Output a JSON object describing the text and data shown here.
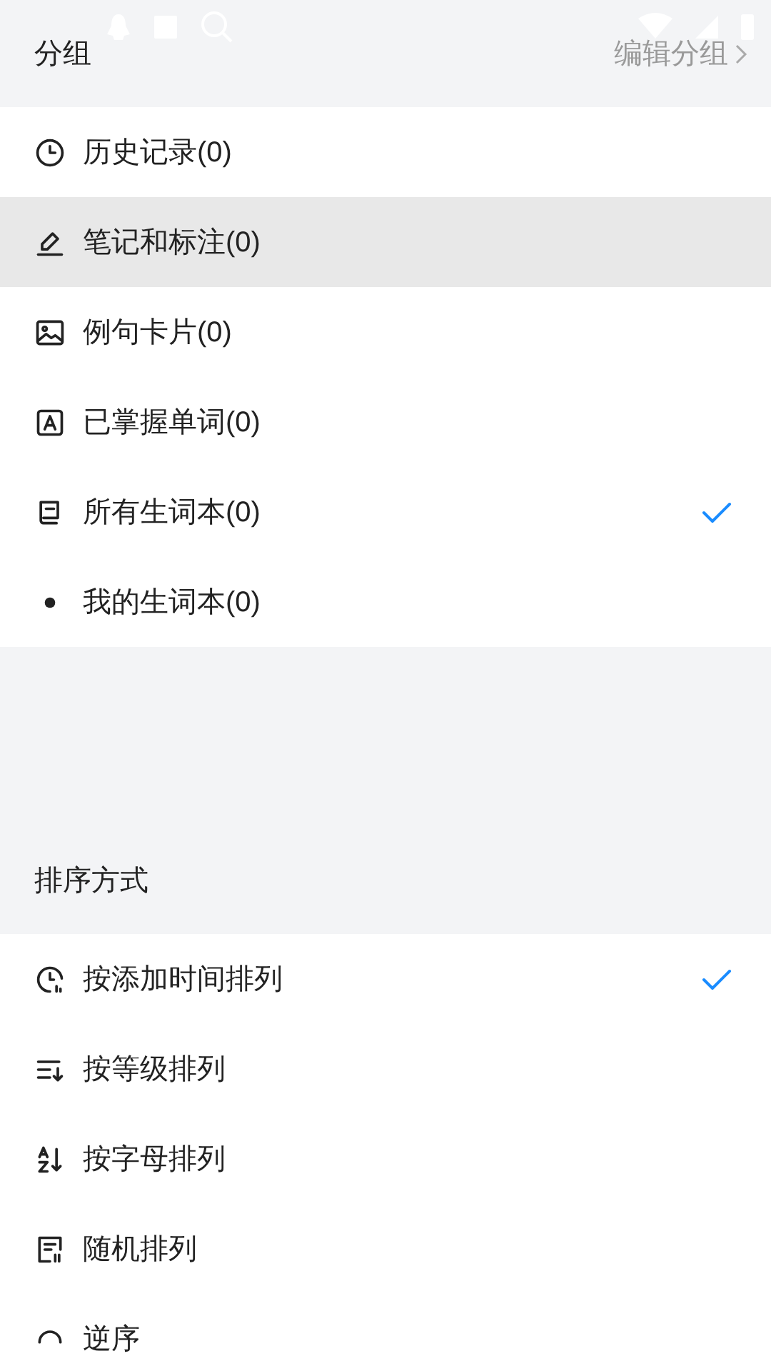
{
  "groups": {
    "title": "分组",
    "edit_link": "编辑分组",
    "items": [
      {
        "kind": "history",
        "label": "历史记录(0)",
        "selected": false,
        "highlighted": false
      },
      {
        "kind": "notes",
        "label": "笔记和标注(0)",
        "selected": false,
        "highlighted": true
      },
      {
        "kind": "cards",
        "label": "例句卡片(0)",
        "selected": false,
        "highlighted": false
      },
      {
        "kind": "mastered",
        "label": "已掌握单词(0)",
        "selected": false,
        "highlighted": false
      },
      {
        "kind": "book",
        "label": "所有生词本(0)",
        "selected": true,
        "highlighted": false
      },
      {
        "kind": "dot",
        "label": "我的生词本(0)",
        "selected": false,
        "highlighted": false
      }
    ]
  },
  "sorting": {
    "title": "排序方式",
    "items": [
      {
        "kind": "time",
        "label": "按添加时间排列",
        "selected": true
      },
      {
        "kind": "level",
        "label": "按等级排列",
        "selected": false
      },
      {
        "kind": "alpha",
        "label": "按字母排列",
        "selected": false
      },
      {
        "kind": "random",
        "label": "随机排列",
        "selected": false
      },
      {
        "kind": "reverse",
        "label": "逆序",
        "selected": false
      }
    ]
  }
}
